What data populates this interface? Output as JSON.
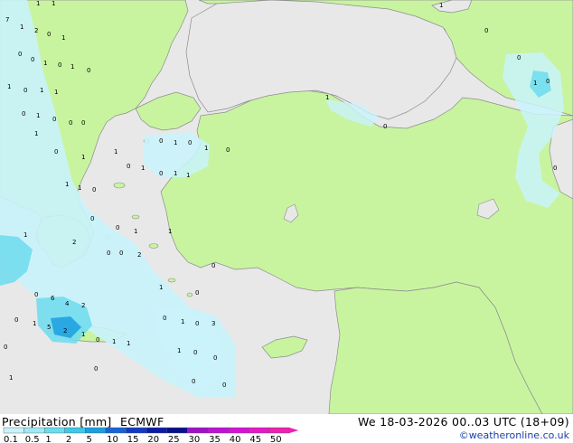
{
  "title": "Precipitation [mm]",
  "model": "ECMWF",
  "valid_time": "We 18-03-2026 00..03 UTC (18+09)",
  "credit": "©weatheronline.co.uk",
  "legend": {
    "ticks": [
      "0.1",
      "0.5",
      "1",
      "2",
      "5",
      "10",
      "15",
      "20",
      "25",
      "30",
      "35",
      "40",
      "45",
      "50"
    ],
    "colors": [
      "#c9f3fb",
      "#9ee9f6",
      "#6cdcef",
      "#3dc8ea",
      "#1b9fe0",
      "#1664d8",
      "#1338c4",
      "#0c1aa8",
      "#08108c",
      "#a010c8",
      "#c010d8",
      "#d810d8",
      "#e818c8",
      "#f020b0"
    ]
  },
  "colors": {
    "land": "#c8f4a0",
    "sea": "#e8e8e8",
    "border": "#8c8c8c",
    "precip_light": "#c9f3fb",
    "precip_medium": "#6cdcef",
    "precip_heavy": "#1b9fe0"
  },
  "grid_values": [
    "1",
    "1",
    "7",
    "1",
    "2",
    "0",
    "1",
    "0",
    "0",
    "1",
    "0",
    "1",
    "0",
    "1",
    "0",
    "1",
    "1",
    "0",
    "1",
    "0",
    "0",
    "0",
    "1",
    "0",
    "1",
    "1",
    "1",
    "0",
    "1",
    "0",
    "1",
    "0",
    "1",
    "0",
    "1",
    "0",
    "1",
    "1",
    "0",
    "0",
    "1",
    "1",
    "2",
    "0",
    "0",
    "2",
    "0",
    "6",
    "4",
    "2",
    "0",
    "1",
    "5",
    "2",
    "1",
    "0",
    "1",
    "1",
    "0",
    "1",
    "0",
    "3",
    "0",
    "0",
    "1",
    "0",
    "0",
    "1",
    "0",
    "0",
    "1",
    "0",
    "1",
    "0",
    "1",
    "0",
    "0",
    "1",
    "0",
    "0",
    "1",
    "0",
    "0"
  ]
}
